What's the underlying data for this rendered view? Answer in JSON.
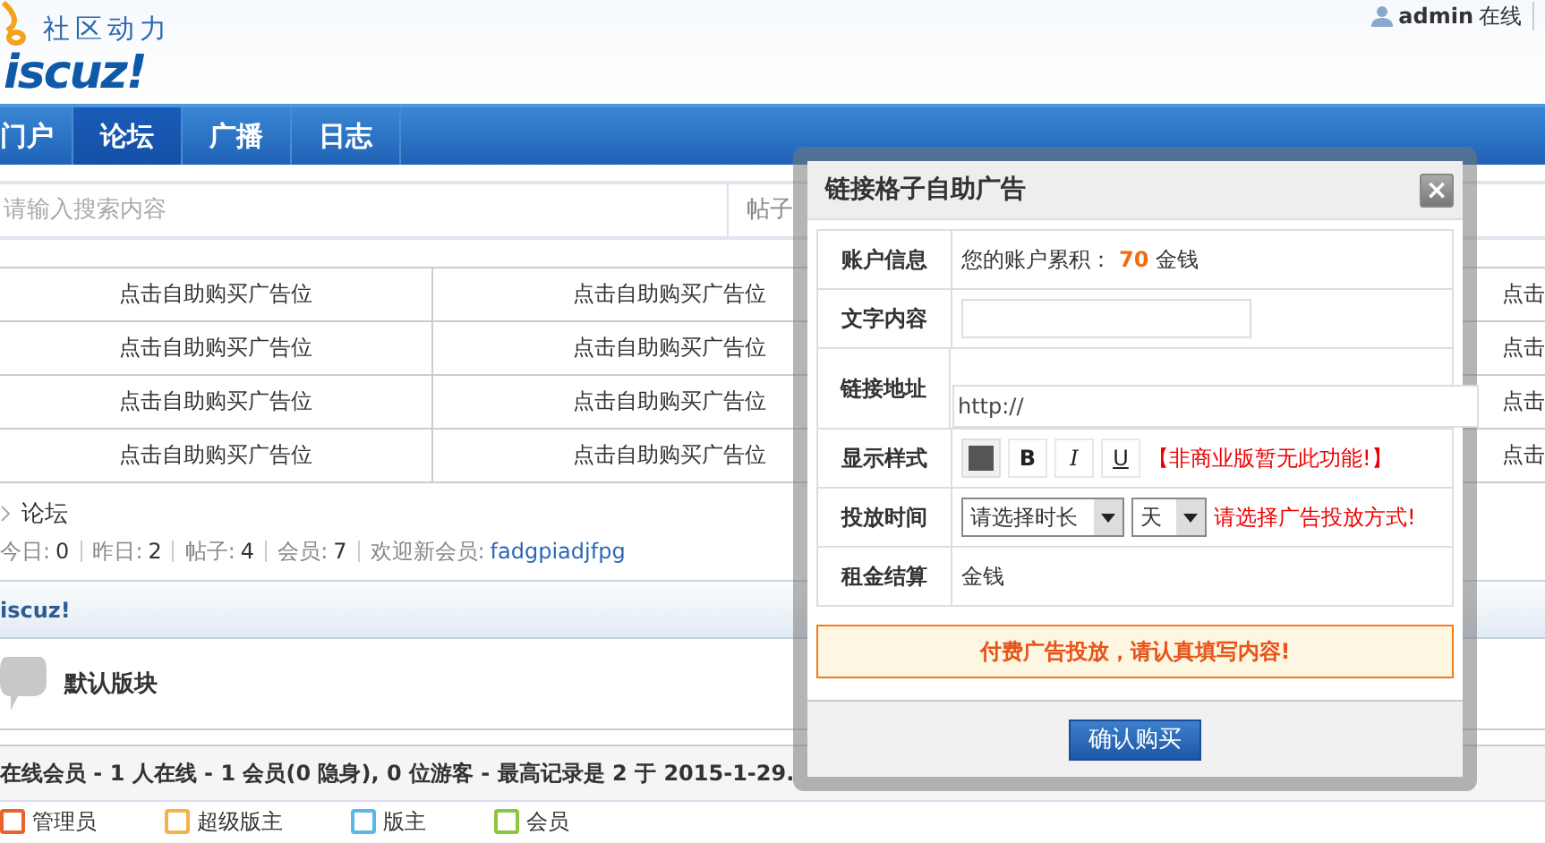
{
  "header": {
    "logo_tagline": "社区动力",
    "logo_text": "iscuz!",
    "user": "admin",
    "user_status": "在线"
  },
  "nav": [
    {
      "label": "门户",
      "selected": false
    },
    {
      "label": "论坛",
      "selected": true
    },
    {
      "label": "广播",
      "selected": false
    },
    {
      "label": "日志",
      "selected": false
    }
  ],
  "search": {
    "placeholder": "请输入搜索内容",
    "scope": "帖子"
  },
  "ad_grid": [
    [
      "点击自助购买广告位",
      "点击自助购买广告位",
      "点击"
    ],
    [
      "点击自助购买广告位",
      "点击自助购买广告位",
      "点击"
    ],
    [
      "点击自助购买广告位",
      "点击自助购买广告位",
      "点击"
    ],
    [
      "点击自助购买广告位",
      "点击自助购买广告位",
      "点击"
    ]
  ],
  "breadcrumb": [
    "论坛"
  ],
  "stats": [
    {
      "label": "今日:",
      "value": "0"
    },
    {
      "label": "昨日:",
      "value": "2"
    },
    {
      "label": "帖子:",
      "value": "4"
    },
    {
      "label": "会员:",
      "value": "7"
    }
  ],
  "new_member": {
    "label": "欢迎新会员:",
    "name": "fadgpiadjfpg"
  },
  "category_title": "iscuz!",
  "forums": [
    {
      "name": "默认版块"
    }
  ],
  "online": "在线会员 - 1 人在线 - 1 会员(0 隐身), 0 位游客 - 最高记录是 2 于 2015-1-29.",
  "legend": [
    {
      "label": "管理员",
      "color": "#e8622a"
    },
    {
      "label": "超级版主",
      "color": "#f4b24a"
    },
    {
      "label": "版主",
      "color": "#5ab8e8"
    },
    {
      "label": "会员",
      "color": "#8cc63e"
    }
  ],
  "dialog": {
    "title": "链接格子自助广告",
    "close": "×",
    "rows": [
      {
        "label": "账户信息",
        "kind": "info",
        "text": "您的账户累积：",
        "amount": "70",
        "unit": "金钱"
      },
      {
        "label": "文字内容",
        "kind": "input"
      },
      {
        "label": "链接地址",
        "kind": "link",
        "value": "http://"
      },
      {
        "label": "显示样式",
        "kind": "style",
        "buttons": [
          "B",
          "I",
          "U"
        ],
        "note": "【非商业版暂无此功能!】"
      },
      {
        "label": "投放时间",
        "kind": "select",
        "selects": [
          "请选择时长",
          "天"
        ],
        "note": "请选择广告投放方式!"
      },
      {
        "label": "租金结算",
        "kind": "text",
        "text": "金钱"
      }
    ],
    "notice": "付费广告投放，请认真填写内容!",
    "submit": "确认购买"
  }
}
